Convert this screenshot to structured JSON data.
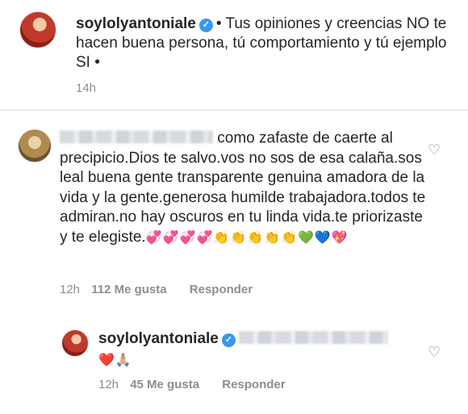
{
  "caption": {
    "username": "soylolyantoniale",
    "text": "• Tus opiniones y creencias NO te hacen buena persona, tú comportamiento y tú ejemplo SI •",
    "time": "14h"
  },
  "comment": {
    "text": "como zafaste de caerte al precipicio.Dios te salvo.vos no sos de esa calaña.sos leal buena gente transparente genuina amadora de la vida y la gente.generosa humilde trabajadora.todos te admiran.no hay oscuros en tu linda vida.te priorizaste y te elegiste.",
    "emojis": "💞💞💞💞👏👏👏👏👏💚💙💖",
    "time": "12h",
    "likes": "112 Me gusta",
    "reply_label": "Responder"
  },
  "reply": {
    "username": "soylolyantoniale",
    "emojis": "❤️🙏🏼",
    "time": "12h",
    "likes": "45 Me gusta",
    "reply_label": "Responder"
  },
  "icons": {
    "verified": "verified-badge-icon",
    "like": "heart-outline-icon"
  },
  "colors": {
    "verified_blue": "#3897f0",
    "meta_gray": "#8e8e8e",
    "text": "#262626"
  }
}
